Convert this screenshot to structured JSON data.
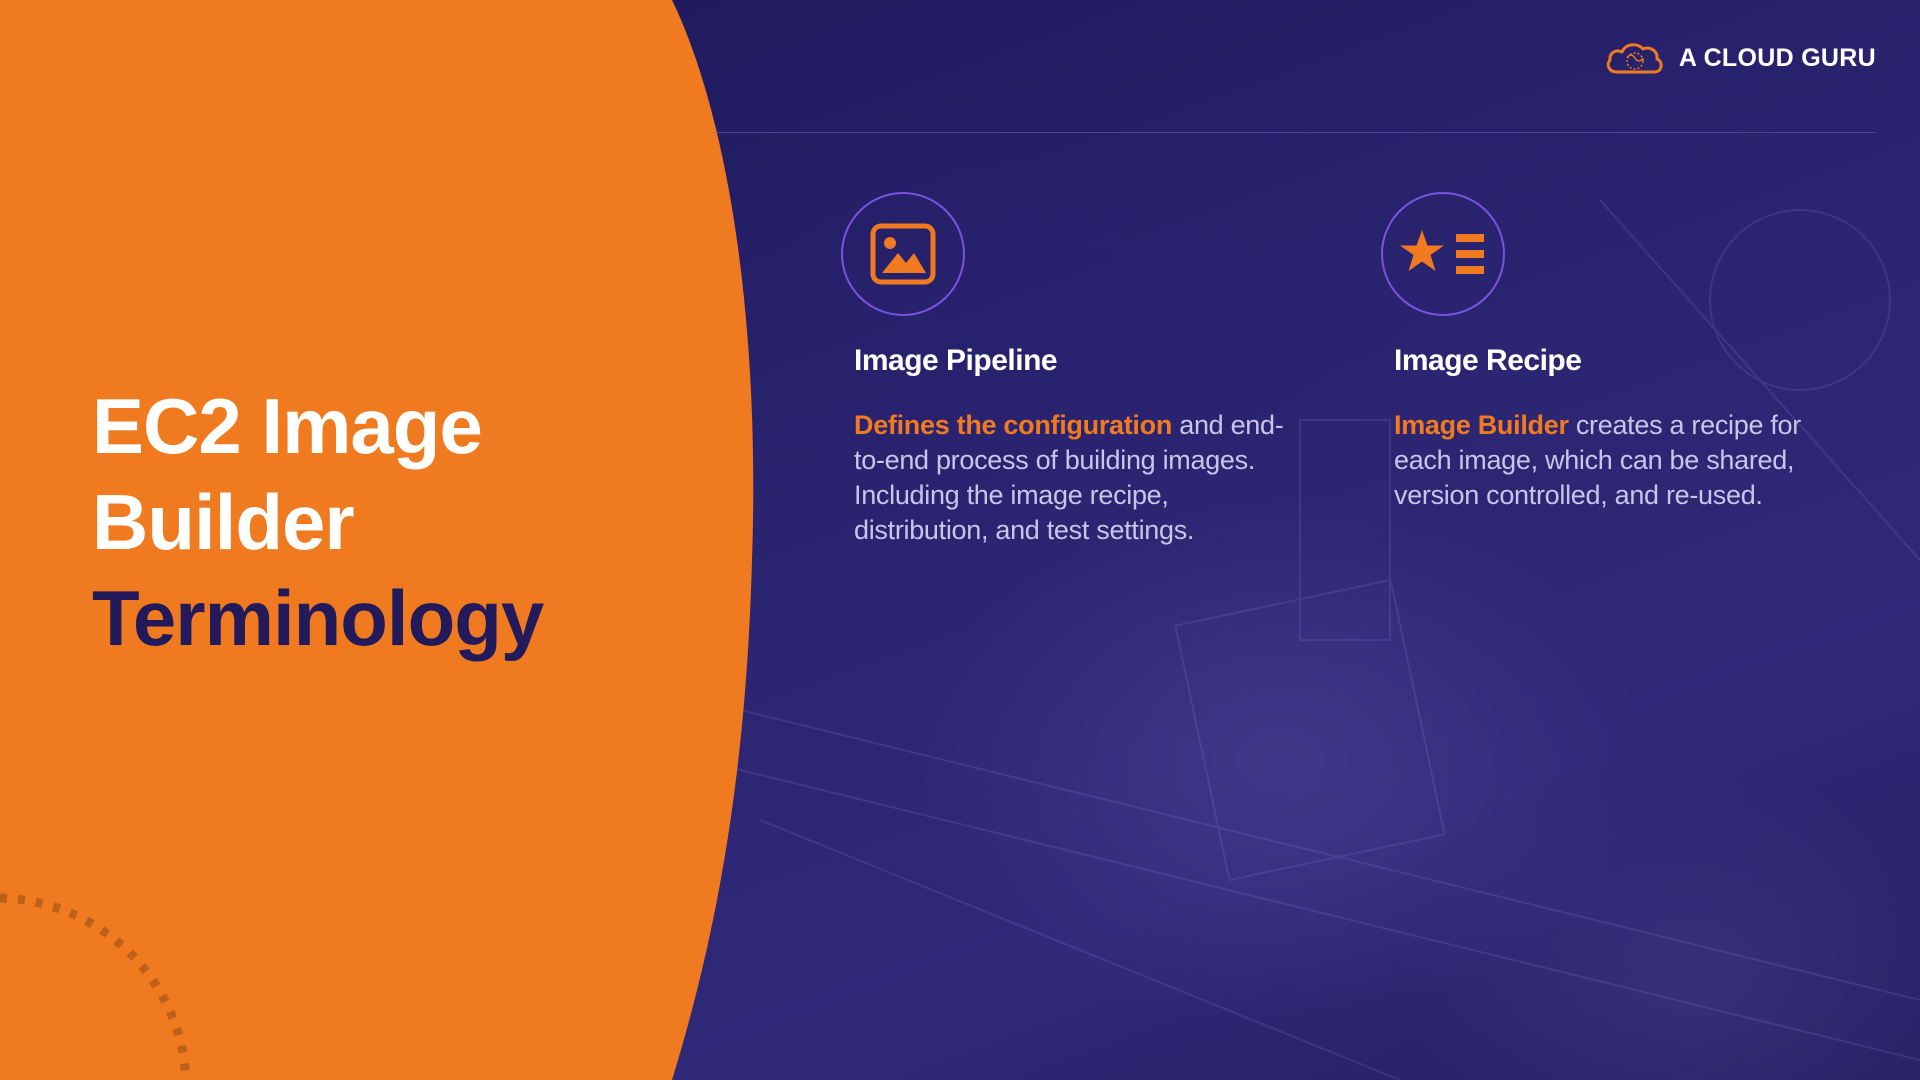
{
  "brand": {
    "name": "A CLOUD GURU",
    "logo_icon": "cloud-logo-icon"
  },
  "title": {
    "line1": "EC2 Image",
    "line2": "Builder",
    "line3": "Terminology"
  },
  "cards": [
    {
      "icon": "image-icon",
      "title": "Image Pipeline",
      "highlight": "Defines the configuration",
      "text": " and end-to-end process of building images. Including the image recipe, distribution, and test settings."
    },
    {
      "icon": "star-list-icon",
      "title": "Image Recipe",
      "highlight": "Image Builder",
      "text": " creates a recipe for each image, which can be shared, version controlled, and re-used."
    }
  ],
  "colors": {
    "orange": "#f07a1f",
    "navy": "#231a5c",
    "background": "#221b5e",
    "icon_ring": "#7b52e0"
  }
}
